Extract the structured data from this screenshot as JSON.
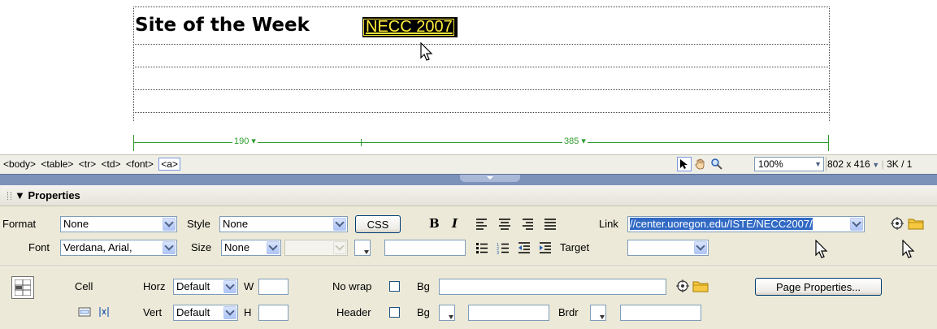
{
  "canvas": {
    "heading": "Site of the Week",
    "selected_link_text": "NECC 2007",
    "ruler_left": "190",
    "ruler_right": "385"
  },
  "statusbar": {
    "tags": [
      "<body>",
      "<table>",
      "<tr>",
      "<td>",
      "<font>"
    ],
    "active_tag": "<a>",
    "zoom": "100%",
    "window_size": "802 x 416",
    "doc_size": "3K / 1"
  },
  "properties": {
    "title": "Properties",
    "format_label": "Format",
    "format_value": "None",
    "style_label": "Style",
    "style_value": "None",
    "css_button": "CSS",
    "bold_label": "B",
    "italic_label": "I",
    "link_label": "Link",
    "link_value": "//center.uoregon.edu/ISTE/NECC2007/",
    "font_label": "Font",
    "font_value": "Verdana, Arial,",
    "size_label": "Size",
    "size_value": "None",
    "target_label": "Target",
    "target_value": "",
    "cell_label": "Cell",
    "horz_label": "Horz",
    "horz_value": "Default",
    "vert_label": "Vert",
    "vert_value": "Default",
    "w_label": "W",
    "h_label": "H",
    "nowrap_label": "No wrap",
    "header_label": "Header",
    "bg_label": "Bg",
    "bg2_label": "Bg",
    "brdr_label": "Brdr",
    "page_properties_button": "Page Properties..."
  },
  "colors": {
    "selection_bg": "#000000",
    "selection_text": "#ffeb3b",
    "ruler": "#2e9b2e",
    "panel_bg": "#ece9d8",
    "divider": "#7d92b9",
    "highlight": "#316ac5"
  }
}
